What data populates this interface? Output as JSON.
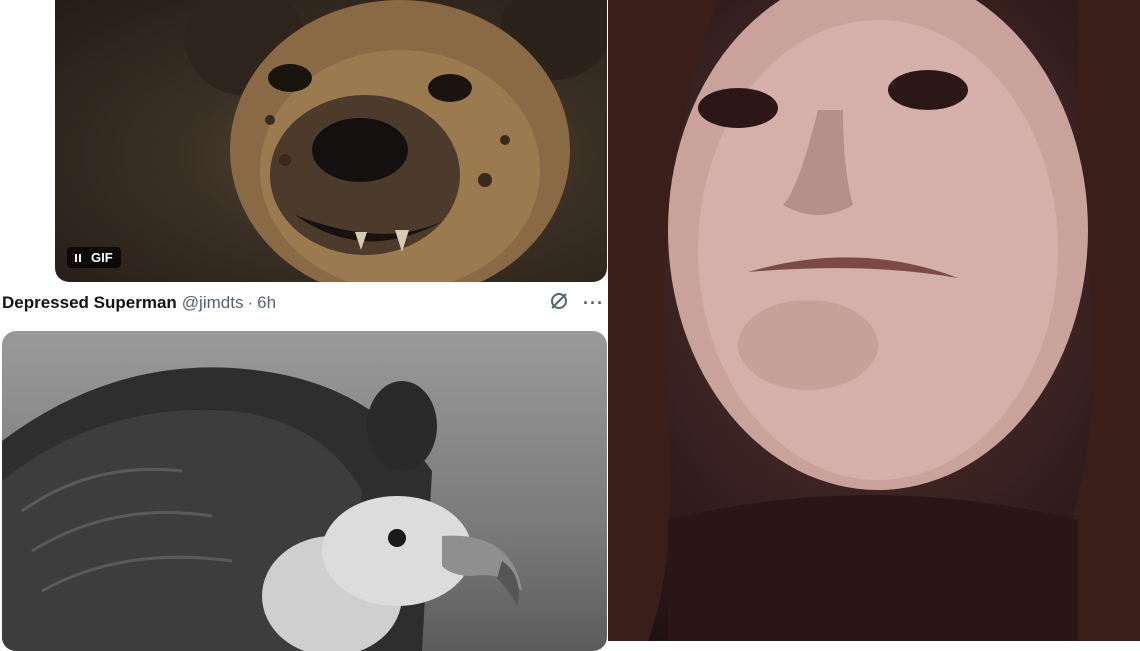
{
  "gif_card": {
    "badge_label": "GIF",
    "pause_icon": "pause-icon"
  },
  "tweet": {
    "author": "Depressed Superman",
    "handle": "@jimdts",
    "separator": "·",
    "time": "6h",
    "grok_icon": "grok-icon",
    "more_label": "···"
  },
  "colors": {
    "author_text": "#0f1419",
    "meta_text": "#536471",
    "photo_tint": "#3a1f1d"
  }
}
